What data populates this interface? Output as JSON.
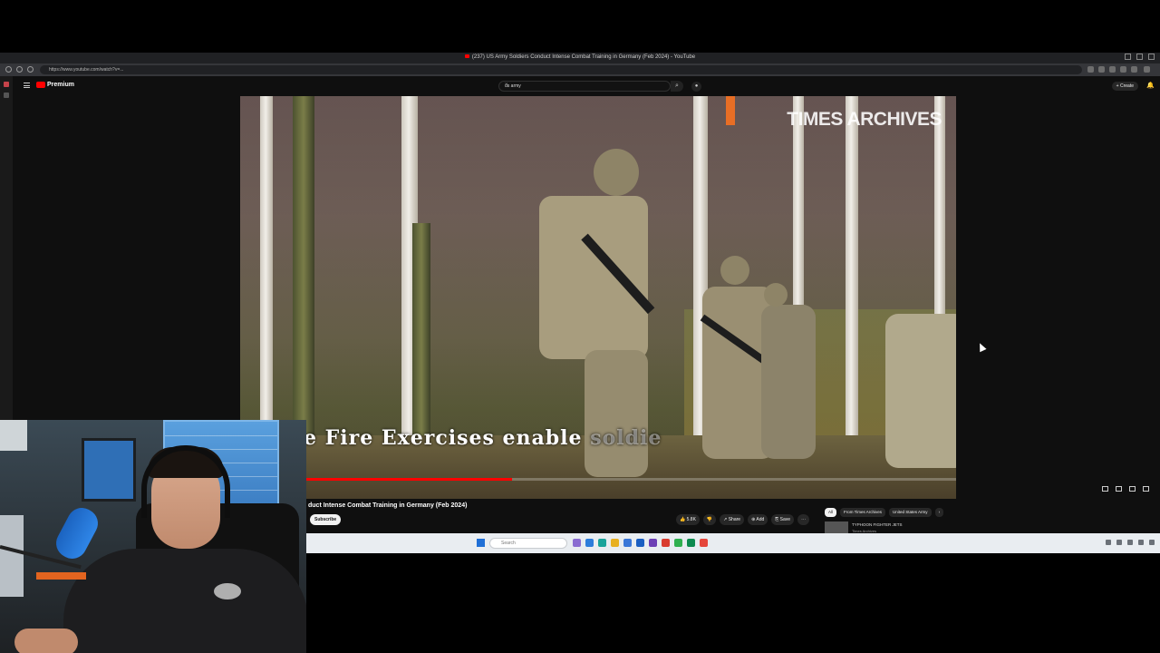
{
  "browser": {
    "tab_title": "(237) US Army Soldiers Conduct Intense Combat Training in Germany (Feb 2024) - YouTube",
    "url": "https://www.youtube.com/watch?v=..."
  },
  "youtube": {
    "logo_text": "Premium",
    "search_query": "us army",
    "create_label": "+ Create",
    "video": {
      "watermark": "TIMES ARCHIVES",
      "subtitle_main": "e Fire Exercises enable",
      "subtitle_faded": " soldie",
      "progress_fraction": 0.38,
      "title": "duct Intense Combat Training in Germany (Feb 2024)"
    },
    "subscribe_label": "Subscribe",
    "actions": [
      "👍 5.8K",
      "👎",
      "↗ Share",
      "⊕ Add",
      "⎘ Save",
      "⋯"
    ],
    "chips": [
      "All",
      "From Times Archives",
      "United States Army",
      "›"
    ],
    "recommendation": {
      "title": "TYPHOON FIGHTER JETS",
      "subtitle": "Times Archives"
    },
    "taskbar_search": "Search"
  },
  "colors": {
    "yt_red": "#ff0000",
    "page_bg": "#0f0f0f",
    "mic_blue": "#2f86e8",
    "taskbar": "#e9edf1"
  }
}
